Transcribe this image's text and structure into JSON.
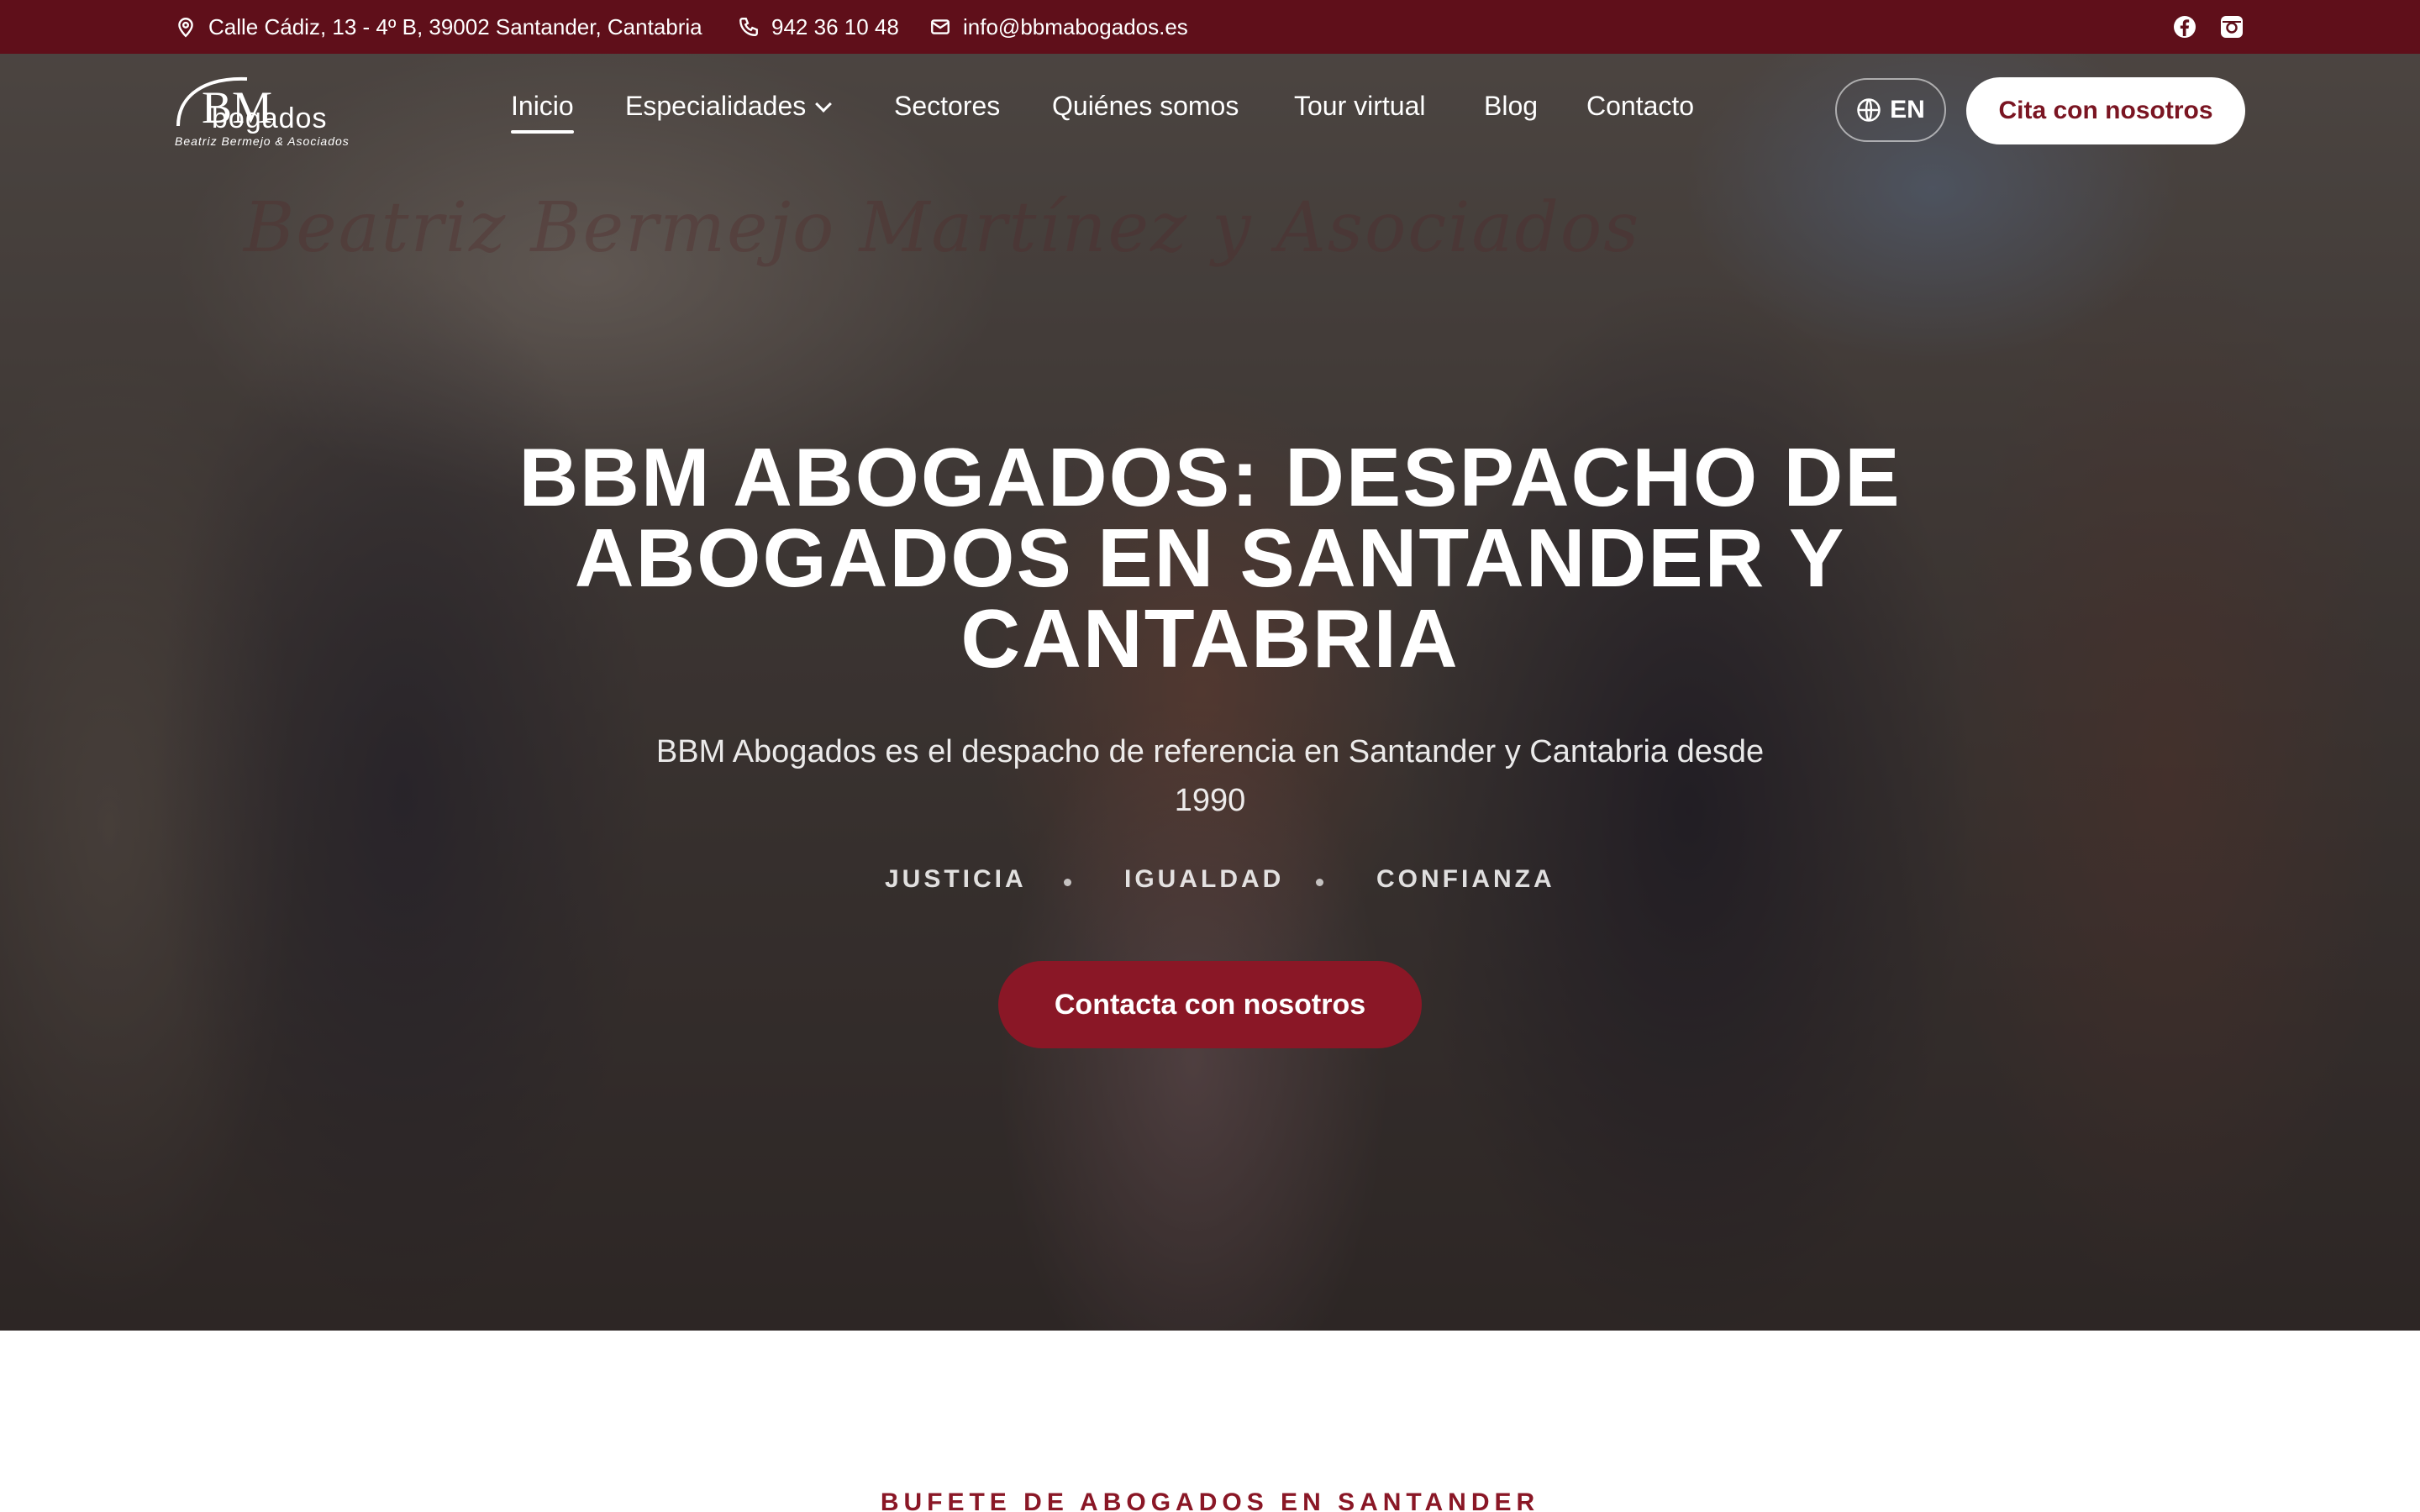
{
  "topbar": {
    "address": "Calle Cádiz, 13 - 4º B, 39002 Santander, Cantabria",
    "phone": "942 36 10 48",
    "email": "info@bbmabogados.es",
    "social": [
      "facebook-icon",
      "instagram-icon"
    ]
  },
  "brand": {
    "logo_mark": "BM",
    "name": "bogados",
    "subtitle": "Beatriz Bermejo & Asociados"
  },
  "nav": {
    "items": [
      {
        "label": "Inicio",
        "active": true
      },
      {
        "label": "Especialidades",
        "dropdown": true
      },
      {
        "label": "Sectores"
      },
      {
        "label": "Quiénes somos"
      },
      {
        "label": "Tour virtual"
      },
      {
        "label": "Blog"
      },
      {
        "label": "Contacto"
      }
    ],
    "language": "EN",
    "cta": "Cita con nosotros"
  },
  "hero": {
    "watermark": "Beatriz Bermejo Martínez y Asociados",
    "title": "BBM ABOGADOS: DESPACHO DE ABOGADOS EN SANTANDER Y CANTABRIA",
    "subtitle": "BBM Abogados es el despacho de referencia en Santander y Cantabria desde 1990",
    "values": [
      "JUSTICIA",
      "IGUALDAD",
      "CONFIANZA"
    ],
    "cta": "Contacta con nosotros"
  },
  "section": {
    "label": "BUFETE DE ABOGADOS EN SANTANDER"
  },
  "colors": {
    "brand": "#5f0f1a",
    "accent": "#8a1726",
    "white": "#ffffff"
  }
}
